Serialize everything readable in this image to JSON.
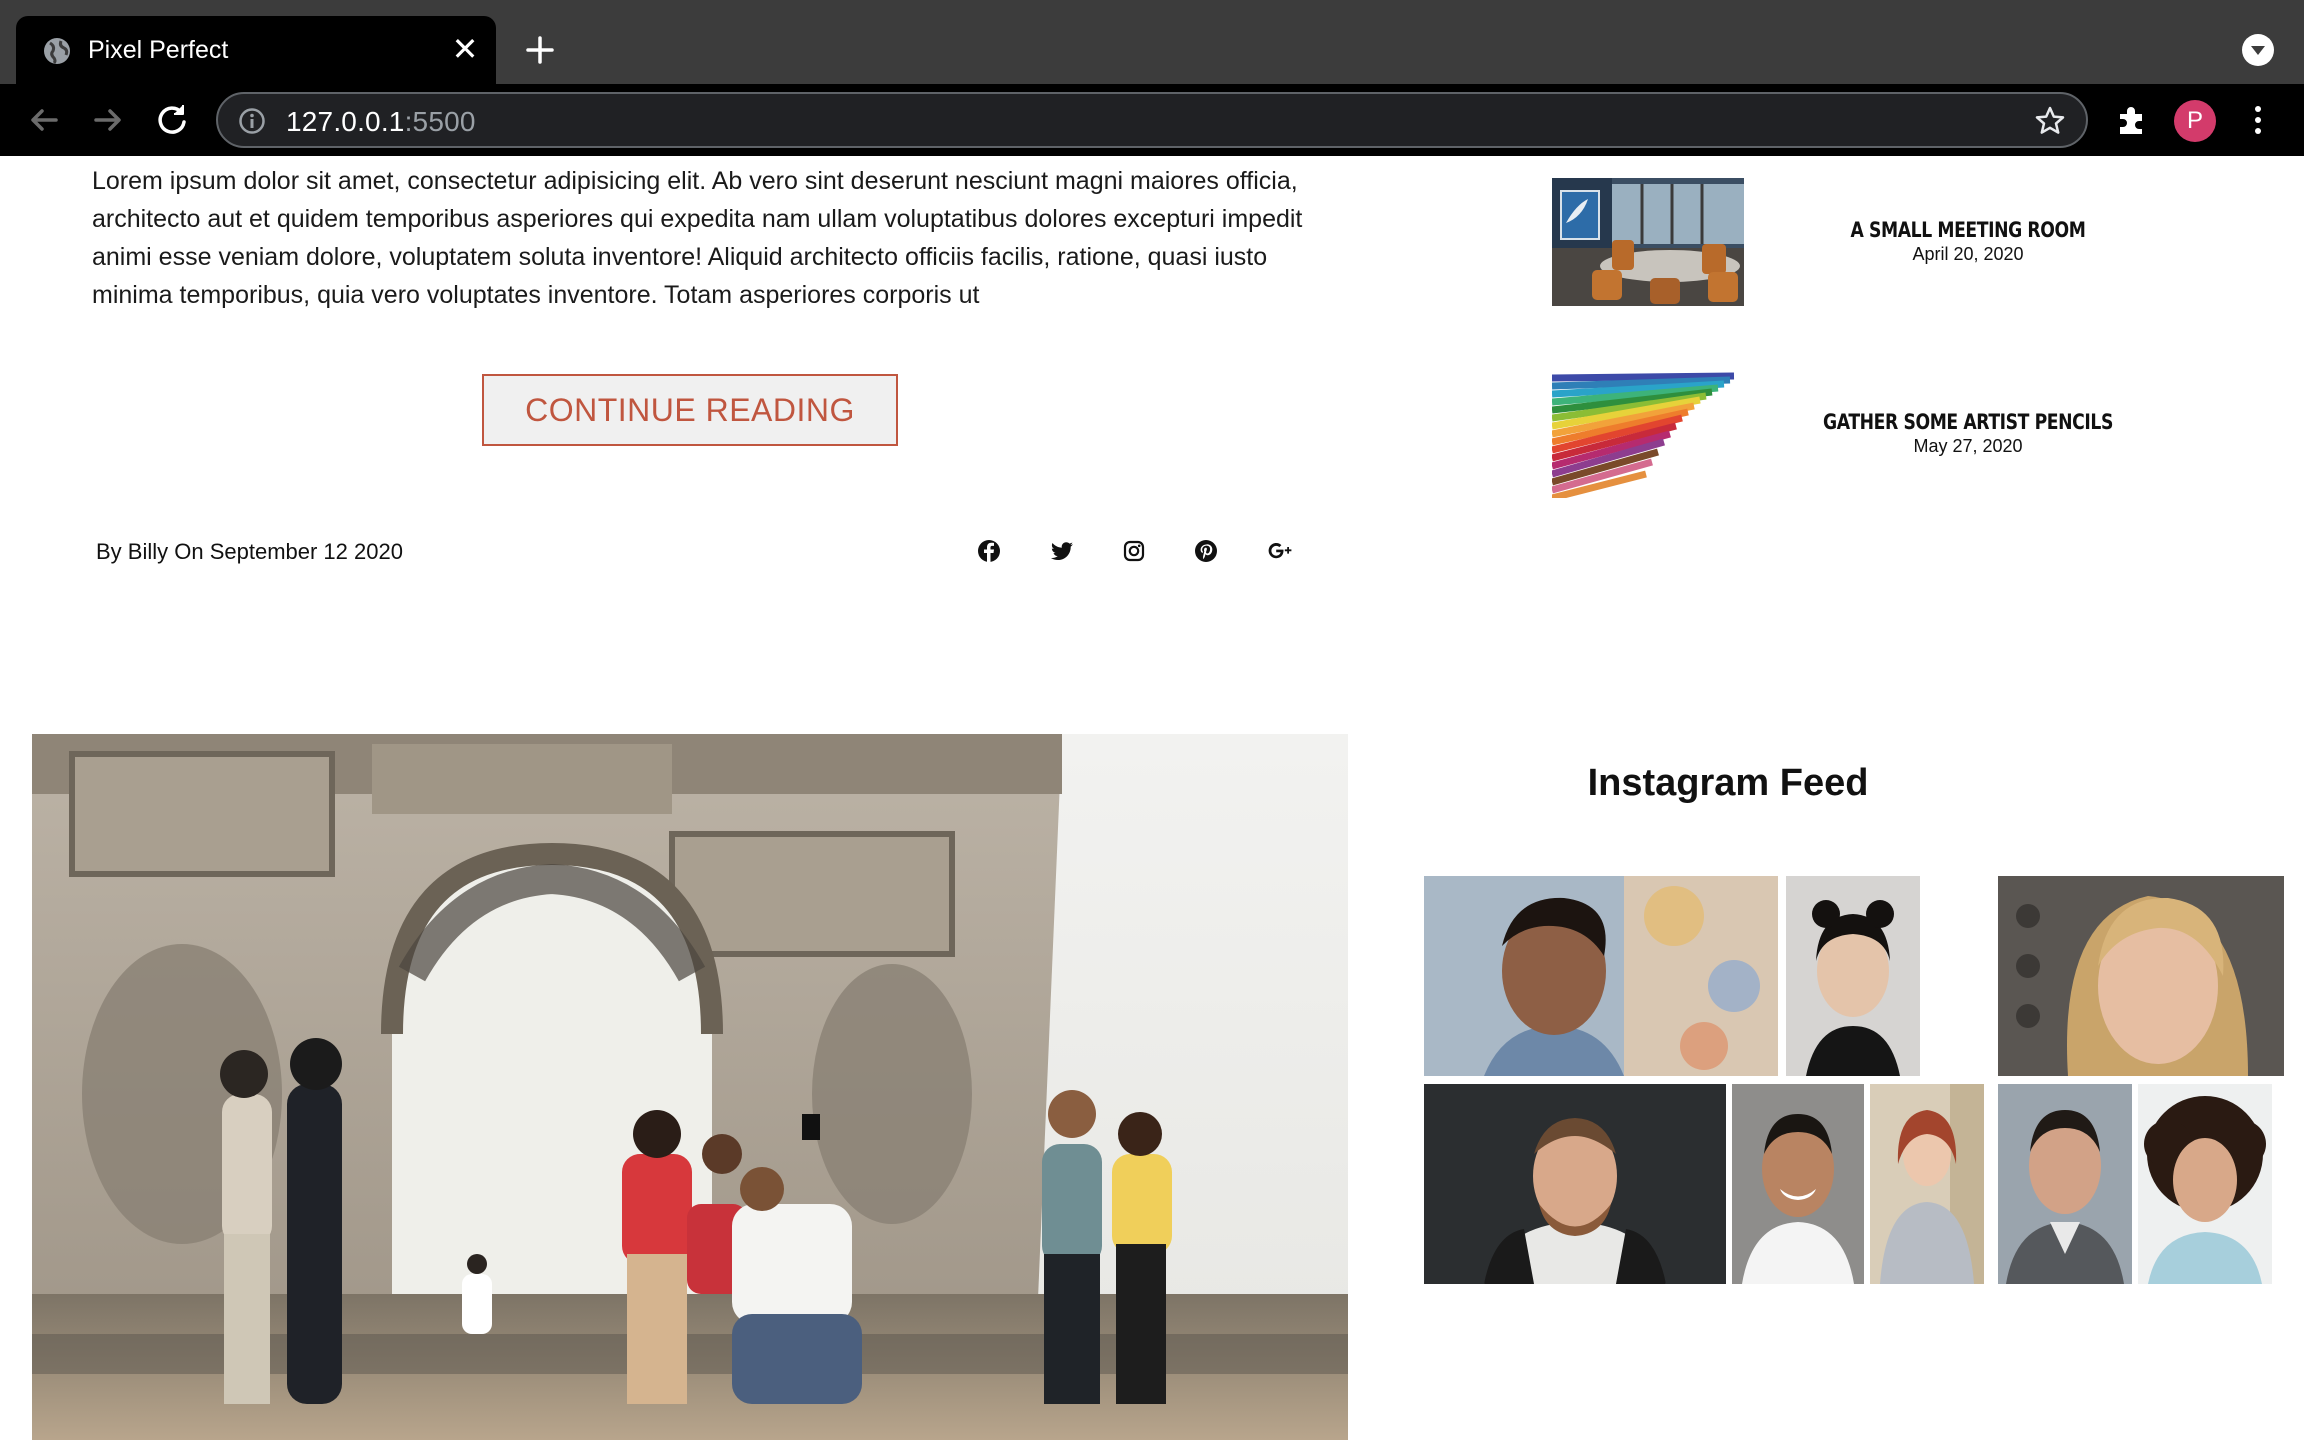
{
  "browser": {
    "tab_title": "Pixel Perfect",
    "url_host": "127.0.0.1",
    "url_port": ":5500",
    "profile_initial": "P"
  },
  "post": {
    "excerpt": "Lorem ipsum dolor sit amet, consectetur adipisicing elit. Ab vero sint deserunt nesciunt magni maiores officia, architecto aut et quidem temporibus asperiores qui expedita nam ullam voluptatibus dolores excepturi impedit animi esse veniam dolore, voluptatem soluta inventore! Aliquid architecto officiis facilis, ratione, quasi iusto minima temporibus, quia vero voluptates inventore. Totam asperiores corporis ut",
    "continue_label": "CONTINUE READING",
    "byline": "By Billy On September 12 2020",
    "social_icons": [
      "facebook-icon",
      "twitter-icon",
      "instagram-icon",
      "pinterest-icon",
      "google-plus-icon"
    ]
  },
  "sidebar": {
    "recent_posts": [
      {
        "title": "A SMALL MEETING ROOM",
        "date": "April 20, 2020"
      },
      {
        "title": "GATHER SOME ARTIST PENCILS",
        "date": "May 27, 2020"
      }
    ],
    "instagram_heading": "Instagram Feed"
  },
  "colors": {
    "accent": "#c0563f",
    "avatar": "#d33b6b",
    "chrome_dark": "#3c3c3c"
  }
}
